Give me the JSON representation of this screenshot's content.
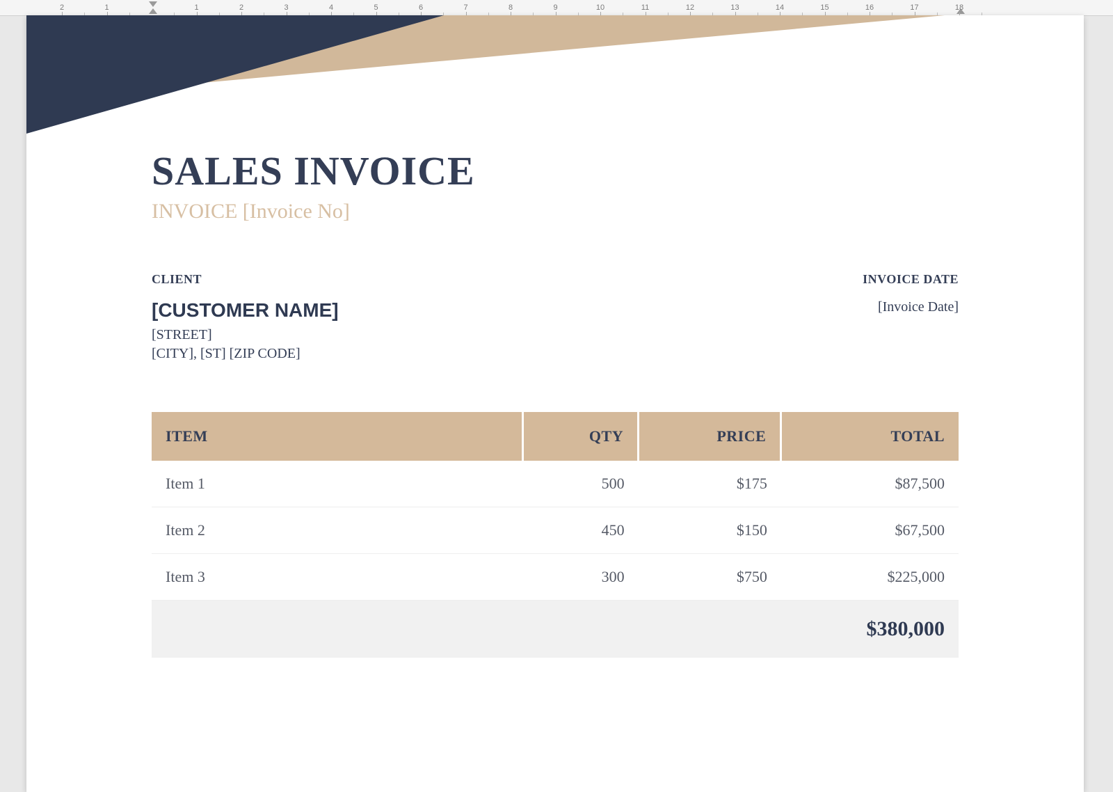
{
  "ruler": {
    "left_labels": [
      "2",
      "1"
    ],
    "right_labels": [
      "1",
      "2",
      "3",
      "4",
      "5",
      "6",
      "7",
      "8",
      "9",
      "10",
      "11",
      "12",
      "13",
      "14",
      "15",
      "16",
      "17",
      "18"
    ]
  },
  "doc": {
    "title": "SALES INVOICE",
    "subtitle": "INVOICE [Invoice No]",
    "client_label": "CLIENT",
    "customer_name": "[CUSTOMER NAME]",
    "street": "[STREET]",
    "city_line": "[CITY], [ST] [ZIP CODE]",
    "date_label": "INVOICE DATE",
    "date_value": "[Invoice Date]"
  },
  "table": {
    "headers": {
      "item": "ITEM",
      "qty": "QTY",
      "price": "PRICE",
      "total": "TOTAL"
    },
    "rows": [
      {
        "item": "Item 1",
        "qty": "500",
        "price": "$175",
        "total": "$87,500"
      },
      {
        "item": "Item 2",
        "qty": "450",
        "price": "$150",
        "total": "$67,500"
      },
      {
        "item": "Item 3",
        "qty": "300",
        "price": "$750",
        "total": "$225,000"
      }
    ],
    "grand_total": "$380,000"
  },
  "colors": {
    "navy": "#2f3a52",
    "tan": "#d4b99a",
    "tan_light": "#d7bfa3"
  }
}
